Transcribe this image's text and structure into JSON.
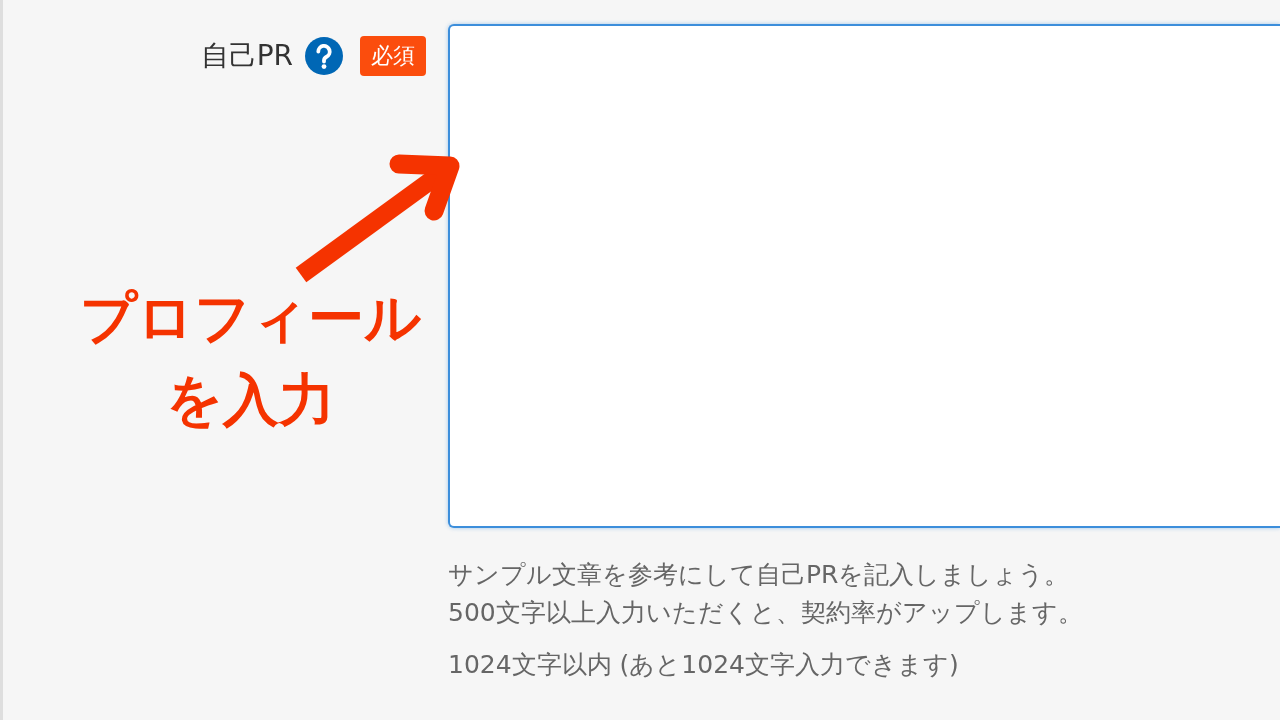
{
  "field": {
    "label": "自己PR",
    "required_badge": "必須",
    "textarea": {
      "focused": true
    },
    "hints": [
      "サンプル文章を参考にして自己PRを記入しましょう。",
      "500文字以上入力いただくと、契約率がアップします。"
    ],
    "counter": "1024文字以内 (あと1024文字入力できます)"
  },
  "annotation": {
    "lines": [
      "プロフィール",
      "を入力"
    ]
  }
}
